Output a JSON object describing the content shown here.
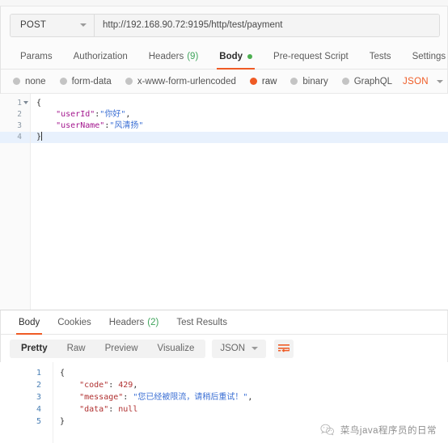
{
  "request": {
    "method": "POST",
    "url": "http://192.168.90.72:9195/http/test/payment",
    "tabs": [
      {
        "label": "Params",
        "active": false
      },
      {
        "label": "Authorization",
        "active": false
      },
      {
        "label": "Headers",
        "count": "(9)",
        "active": false
      },
      {
        "label": "Body",
        "active": true,
        "dot": true
      },
      {
        "label": "Pre-request Script",
        "active": false
      },
      {
        "label": "Tests",
        "active": false
      },
      {
        "label": "Settings",
        "active": false
      }
    ],
    "body_types": [
      {
        "label": "none",
        "selected": false
      },
      {
        "label": "form-data",
        "selected": false
      },
      {
        "label": "x-www-form-urlencoded",
        "selected": false
      },
      {
        "label": "raw",
        "selected": true
      },
      {
        "label": "binary",
        "selected": false
      },
      {
        "label": "GraphQL",
        "selected": false
      }
    ],
    "format": "JSON",
    "editor": {
      "line_numbers": [
        "1",
        "2",
        "3",
        "4"
      ],
      "lines": [
        {
          "text": "{",
          "type": "punct"
        },
        {
          "key": "\"userId\"",
          "sep": ":",
          "value": "\"你好\"",
          "trail": ","
        },
        {
          "key": "\"userName\"",
          "sep": ":",
          "value": "\"风清扬\"",
          "trail": ""
        },
        {
          "text": "}",
          "type": "punct"
        }
      ],
      "current_line": 4
    }
  },
  "response": {
    "tabs": [
      {
        "label": "Body",
        "active": true
      },
      {
        "label": "Cookies",
        "active": false
      },
      {
        "label": "Headers",
        "count": "(2)",
        "active": false
      },
      {
        "label": "Test Results",
        "active": false
      }
    ],
    "view_modes": [
      {
        "label": "Pretty",
        "active": true
      },
      {
        "label": "Raw",
        "active": false
      },
      {
        "label": "Preview",
        "active": false
      },
      {
        "label": "Visualize",
        "active": false
      }
    ],
    "format": "JSON",
    "wrap_icon": "word-wrap-icon",
    "editor": {
      "line_numbers": [
        "1",
        "2",
        "3",
        "4",
        "5"
      ],
      "lines": [
        {
          "text": "{",
          "type": "punct"
        },
        {
          "key": "\"code\"",
          "sep": ": ",
          "value": "429",
          "vtype": "num",
          "trail": ","
        },
        {
          "key": "\"message\"",
          "sep": ": ",
          "value": "\"您已经被限流，请稍后重试！\"",
          "vtype": "str",
          "trail": ","
        },
        {
          "key": "\"data\"",
          "sep": ": ",
          "value": "null",
          "vtype": "null",
          "trail": ""
        },
        {
          "text": "}",
          "type": "punct"
        }
      ]
    }
  },
  "watermark": {
    "icon": "wechat-icon",
    "text": "菜鸟java程序员的日常"
  },
  "colors": {
    "accent": "#ef5b25",
    "green": "#3fa45b",
    "current_line": "#e8f1fd",
    "string": "#3b6fd4",
    "key": "#a3168e"
  }
}
